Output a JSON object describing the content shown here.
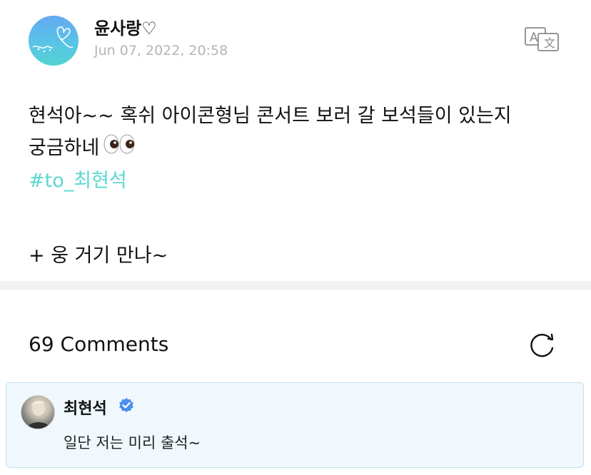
{
  "post": {
    "author_name": "윤사랑♡",
    "date": "Jun 07, 2022, 20:58",
    "body_line1": "현석아~~ 혹쉬 아이콘형님 콘서트 보러 갈 보석들이 있는지",
    "body_line2": "궁금하네",
    "body_emoji": "eyes-emoji",
    "hashtag": "#to_최현석",
    "body_line4": "+ 웅 거기 만나~",
    "avatar_gradient": [
      "#64a9f2",
      "#54d2d2"
    ],
    "hashtag_color": "#5ad8d0"
  },
  "comments": {
    "title": "69 Comments",
    "refresh_icon": "refresh-icon"
  },
  "comment": {
    "author": "최현석",
    "verified_color": "#4a8ff0",
    "text": "일단 저는 미리 출석~"
  },
  "icons": {
    "translate": "translate-icon"
  }
}
